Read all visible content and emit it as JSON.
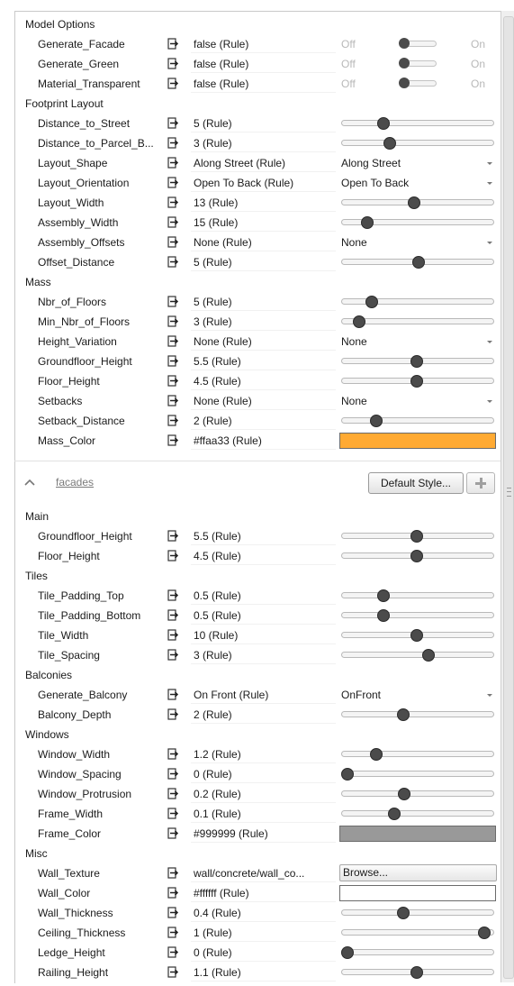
{
  "colors": {
    "knob": "#4b4b4b",
    "mass_swatch": "#ffaa33",
    "frame_swatch": "#999999",
    "wall_swatch": "#ffffff",
    "toggle_text": "#b8b8b8"
  },
  "model_options": {
    "title": "Model Options",
    "rows": [
      {
        "label": "Generate_Facade",
        "value": "false (Rule)",
        "control": {
          "type": "toggle",
          "off_label": "Off",
          "on_label": "On",
          "state": "off"
        }
      },
      {
        "label": "Generate_Green",
        "value": "false (Rule)",
        "control": {
          "type": "toggle",
          "off_label": "Off",
          "on_label": "On",
          "state": "off"
        }
      },
      {
        "label": "Material_Transparent",
        "value": "false (Rule)",
        "control": {
          "type": "toggle",
          "off_label": "Off",
          "on_label": "On",
          "state": "off"
        }
      }
    ]
  },
  "footprint_layout": {
    "title": "Footprint Layout",
    "rows": [
      {
        "label": "Distance_to_Street",
        "value": "5 (Rule)",
        "control": {
          "type": "slider",
          "level": 0.25
        }
      },
      {
        "label": "Distance_to_Parcel_B...",
        "value": "3 (Rule)",
        "control": {
          "type": "slider",
          "level": 0.3
        }
      },
      {
        "label": "Layout_Shape",
        "value": "Along Street (Rule)",
        "control": {
          "type": "dropdown",
          "selected": "Along Street"
        }
      },
      {
        "label": "Layout_Orientation",
        "value": "Open To Back (Rule)",
        "control": {
          "type": "dropdown",
          "selected": "Open To Back"
        }
      },
      {
        "label": "Layout_Width",
        "value": "13 (Rule)",
        "control": {
          "type": "slider",
          "level": 0.47
        }
      },
      {
        "label": "Assembly_Width",
        "value": "15 (Rule)",
        "control": {
          "type": "slider",
          "level": 0.14
        }
      },
      {
        "label": "Assembly_Offsets",
        "value": "None (Rule)",
        "control": {
          "type": "dropdown",
          "selected": "None"
        }
      },
      {
        "label": "Offset_Distance",
        "value": "5 (Rule)",
        "control": {
          "type": "slider",
          "level": 0.5
        }
      }
    ]
  },
  "mass": {
    "title": "Mass",
    "rows": [
      {
        "label": "Nbr_of_Floors",
        "value": "5 (Rule)",
        "control": {
          "type": "slider",
          "level": 0.17
        }
      },
      {
        "label": "Min_Nbr_of_Floors",
        "value": "3 (Rule)",
        "control": {
          "type": "slider",
          "level": 0.08
        }
      },
      {
        "label": "Height_Variation",
        "value": "None (Rule)",
        "control": {
          "type": "dropdown",
          "selected": "None"
        }
      },
      {
        "label": "Groundfloor_Height",
        "value": "5.5 (Rule)",
        "control": {
          "type": "slider",
          "level": 0.49
        }
      },
      {
        "label": "Floor_Height",
        "value": "4.5 (Rule)",
        "control": {
          "type": "slider",
          "level": 0.49
        }
      },
      {
        "label": "Setbacks",
        "value": "None (Rule)",
        "control": {
          "type": "dropdown",
          "selected": "None"
        }
      },
      {
        "label": "Setback_Distance",
        "value": "2 (Rule)",
        "control": {
          "type": "slider",
          "level": 0.2
        }
      },
      {
        "label": "Mass_Color",
        "value": "#ffaa33 (Rule)",
        "control": {
          "type": "swatch",
          "color": "#ffaa33"
        }
      }
    ]
  },
  "facades_header": {
    "title": "facades",
    "default_style_label": "Default Style...",
    "add_icon": "plus-icon"
  },
  "main": {
    "title": "Main",
    "rows": [
      {
        "label": "Groundfloor_Height",
        "value": "5.5 (Rule)",
        "control": {
          "type": "slider",
          "level": 0.49
        }
      },
      {
        "label": "Floor_Height",
        "value": "4.5 (Rule)",
        "control": {
          "type": "slider",
          "level": 0.49
        }
      }
    ]
  },
  "tiles": {
    "title": "Tiles",
    "rows": [
      {
        "label": "Tile_Padding_Top",
        "value": "0.5 (Rule)",
        "control": {
          "type": "slider",
          "level": 0.25
        }
      },
      {
        "label": "Tile_Padding_Bottom",
        "value": "0.5 (Rule)",
        "control": {
          "type": "slider",
          "level": 0.25
        }
      },
      {
        "label": "Tile_Width",
        "value": "10 (Rule)",
        "control": {
          "type": "slider",
          "level": 0.49
        }
      },
      {
        "label": "Tile_Spacing",
        "value": "3 (Rule)",
        "control": {
          "type": "slider",
          "level": 0.57
        }
      }
    ]
  },
  "balconies": {
    "title": "Balconies",
    "rows": [
      {
        "label": "Generate_Balcony",
        "value": "On Front (Rule)",
        "control": {
          "type": "dropdown",
          "selected": "OnFront"
        }
      },
      {
        "label": "Balcony_Depth",
        "value": "2 (Rule)",
        "control": {
          "type": "slider",
          "level": 0.39
        }
      }
    ]
  },
  "windows": {
    "title": "Windows",
    "rows": [
      {
        "label": "Window_Width",
        "value": "1.2 (Rule)",
        "control": {
          "type": "slider",
          "level": 0.2
        }
      },
      {
        "label": "Window_Spacing",
        "value": "0 (Rule)",
        "control": {
          "type": "slider",
          "level": 0.0
        }
      },
      {
        "label": "Window_Protrusion",
        "value": "0.2 (Rule)",
        "control": {
          "type": "slider",
          "level": 0.4
        }
      },
      {
        "label": "Frame_Width",
        "value": "0.1 (Rule)",
        "control": {
          "type": "slider",
          "level": 0.33
        }
      },
      {
        "label": "Frame_Color",
        "value": "#999999 (Rule)",
        "control": {
          "type": "swatch",
          "color": "#999999"
        }
      }
    ]
  },
  "misc": {
    "title": "Misc",
    "rows": [
      {
        "label": "Wall_Texture",
        "value": "wall/concrete/wall_co...",
        "control": {
          "type": "button",
          "text": "Browse..."
        }
      },
      {
        "label": "Wall_Color",
        "value": "#ffffff (Rule)",
        "control": {
          "type": "swatch",
          "color": "#ffffff"
        }
      },
      {
        "label": "Wall_Thickness",
        "value": "0.4 (Rule)",
        "control": {
          "type": "slider",
          "level": 0.39
        }
      },
      {
        "label": "Ceiling_Thickness",
        "value": "1 (Rule)",
        "control": {
          "type": "slider",
          "level": 0.96
        }
      },
      {
        "label": "Ledge_Height",
        "value": "0 (Rule)",
        "control": {
          "type": "slider",
          "level": 0.0
        }
      },
      {
        "label": "Railing_Height",
        "value": "1.1 (Rule)",
        "control": {
          "type": "slider",
          "level": 0.49
        }
      }
    ]
  }
}
